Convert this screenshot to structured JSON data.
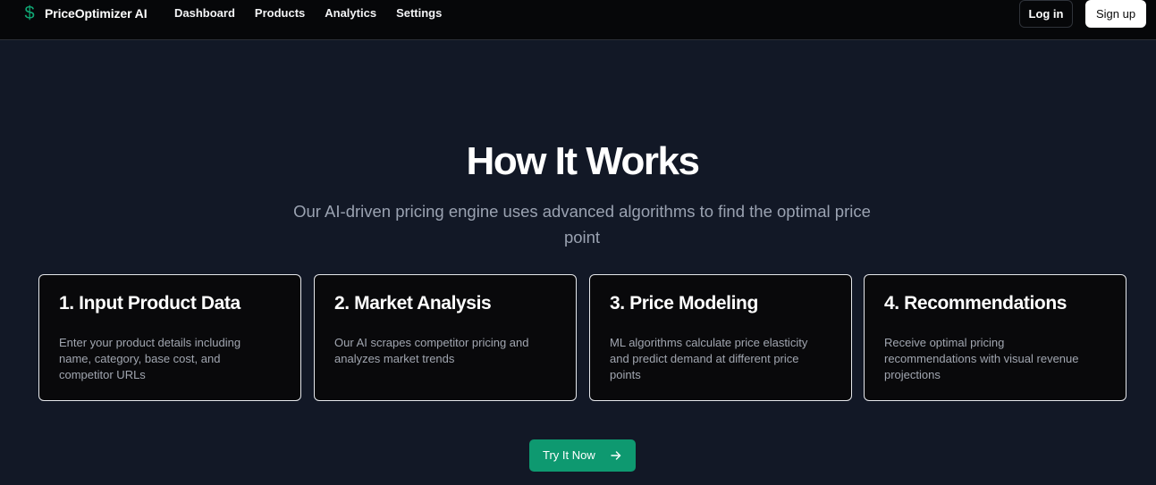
{
  "nav": {
    "brand_icon": "dollar-sign-icon",
    "brand_glyph": "$",
    "brand_name": "PriceOptimizer AI",
    "links": [
      "Dashboard",
      "Products",
      "Analytics",
      "Settings"
    ],
    "login_label": "Log in",
    "signup_label": "Sign up"
  },
  "hero": {
    "title": "How It Works",
    "subtitle": "Our AI-driven pricing engine uses advanced algorithms to find the optimal price point"
  },
  "steps": [
    {
      "title": "1. Input Product Data",
      "description": "Enter your product details including name, category, base cost, and competitor URLs"
    },
    {
      "title": "2. Market Analysis",
      "description": "Our AI scrapes competitor pricing and analyzes market trends"
    },
    {
      "title": "3. Price Modeling",
      "description": "ML algorithms calculate price elasticity and predict demand at different price points"
    },
    {
      "title": "4. Recommendations",
      "description": "Receive optimal pricing recommendations with visual revenue projections"
    }
  ],
  "cta": {
    "label": "Try It Now",
    "icon": "arrow-right-icon"
  },
  "colors": {
    "accent": "#10a875",
    "cta_bg": "#0e9970",
    "page_bg": "#121826",
    "nav_bg": "#060709",
    "card_bg": "#09090b"
  }
}
